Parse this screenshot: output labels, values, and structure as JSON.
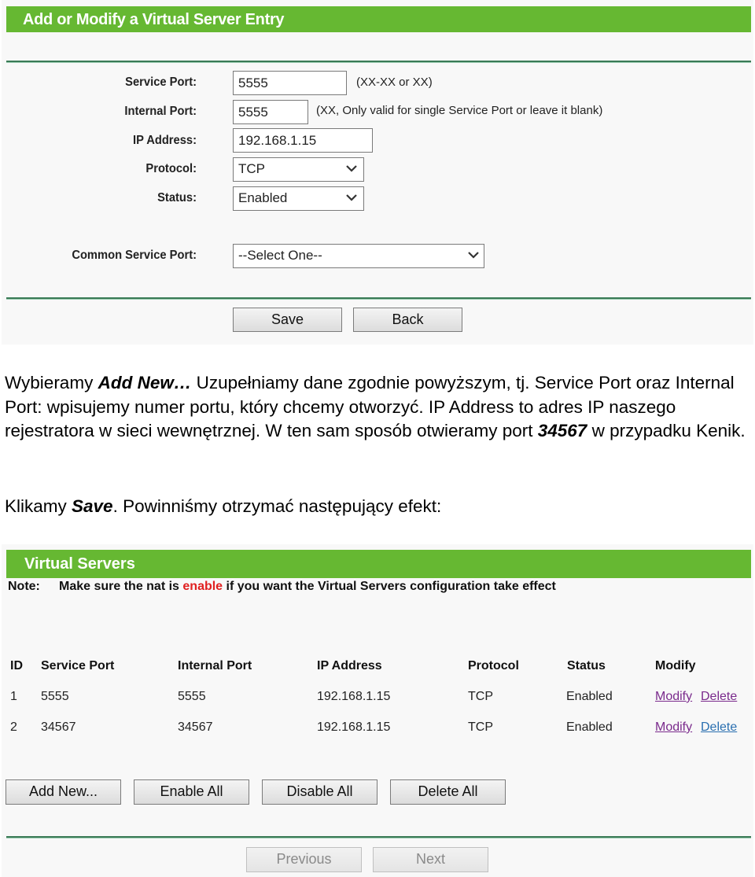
{
  "entry_form": {
    "title": "Add or Modify a Virtual Server Entry",
    "fields": {
      "service_port": {
        "label": "Service Port:",
        "value": "5555",
        "hint": "(XX-XX or XX)"
      },
      "internal_port": {
        "label": "Internal Port:",
        "value": "5555",
        "hint": "(XX, Only valid for single Service Port or leave it blank)"
      },
      "ip_address": {
        "label": "IP Address:",
        "value": "192.168.1.15"
      },
      "protocol": {
        "label": "Protocol:",
        "value": "TCP"
      },
      "status": {
        "label": "Status:",
        "value": "Enabled"
      },
      "common_service_port": {
        "label": "Common Service Port:",
        "value": "--Select One--"
      }
    },
    "buttons": {
      "save": "Save",
      "back": "Back"
    }
  },
  "prose": {
    "p1_a": "Wybieramy ",
    "p1_b": "Add New…",
    "p1_c": " Uzupełniamy dane zgodnie powyższym, tj. Service Port oraz Internal Port: wpisujemy numer portu, który chcemy otworzyć. IP Address to adres IP naszego rejestratora w sieci wewnętrznej. W ten sam sposób otwieramy port ",
    "p1_d": "34567",
    "p1_e": " w przypadku Kenik.",
    "p2_a": "Klikamy ",
    "p2_b": "Save",
    "p2_c": ". Powinniśmy otrzymać następujący efekt:"
  },
  "virtual_servers": {
    "title": "Virtual Servers",
    "note_label": "Note:",
    "note_a": "Make sure the nat is ",
    "note_highlight": "enable",
    "note_b": " if you want the Virtual Servers configuration take effect",
    "columns": [
      "ID",
      "Service Port",
      "Internal Port",
      "IP Address",
      "Protocol",
      "Status",
      "Modify"
    ],
    "rows": [
      {
        "id": "1",
        "service_port": "5555",
        "internal_port": "5555",
        "ip": "192.168.1.15",
        "protocol": "TCP",
        "status": "Enabled",
        "modify": "Modify",
        "delete": "Delete"
      },
      {
        "id": "2",
        "service_port": "34567",
        "internal_port": "34567",
        "ip": "192.168.1.15",
        "protocol": "TCP",
        "status": "Enabled",
        "modify": "Modify",
        "delete": "Delete"
      }
    ],
    "buttons": {
      "add_new": "Add New...",
      "enable_all": "Enable All",
      "disable_all": "Disable All",
      "delete_all": "Delete All",
      "previous": "Previous",
      "next": "Next"
    }
  },
  "colors": {
    "header_green": "#66b832",
    "separator": "#3a7a56",
    "note_red": "#e02020",
    "visited_link": "#7a2a8c",
    "link": "#2a6fb0"
  }
}
